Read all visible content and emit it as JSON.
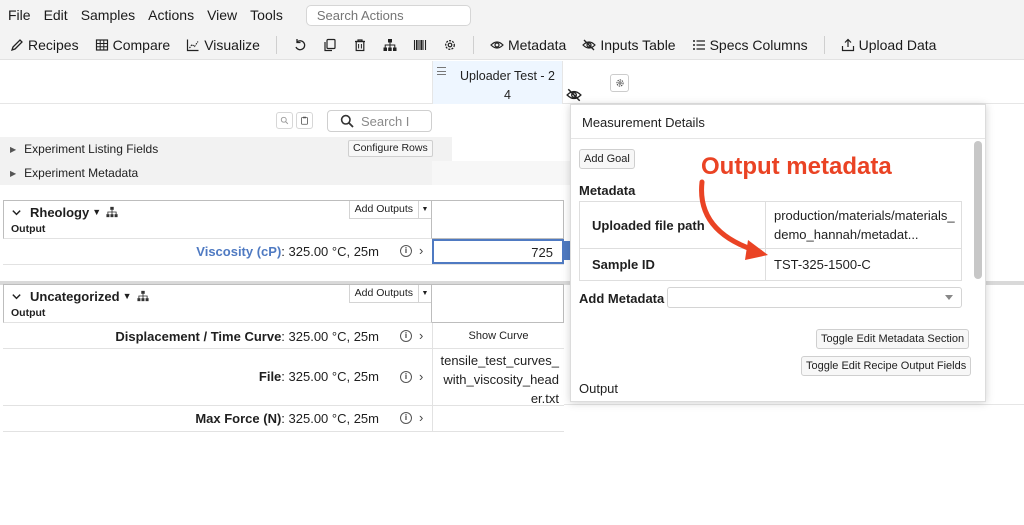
{
  "menubar": {
    "items": [
      "File",
      "Edit",
      "Samples",
      "Actions",
      "View",
      "Tools"
    ],
    "search_placeholder": "Search Actions"
  },
  "toolbar": {
    "recipes": "Recipes",
    "compare": "Compare",
    "visualize": "Visualize",
    "metadata": "Metadata",
    "inputs_table": "Inputs Table",
    "specs_columns": "Specs Columns",
    "upload_data": "Upload Data"
  },
  "sample_column": {
    "title": "Uploader Test - 2 4"
  },
  "search": {
    "placeholder": "Search I"
  },
  "sections": {
    "experiment_listing": "Experiment Listing Fields",
    "configure_rows": "Configure Rows",
    "experiment_metadata": "Experiment Metadata"
  },
  "groups": [
    {
      "name": "Rheology",
      "add_outputs": "Add Outputs",
      "output_label": "Output",
      "rows": [
        {
          "label": "Viscosity (cP)",
          "condition": ": 325.00 °C, 25m",
          "value": "725"
        }
      ]
    },
    {
      "name": "Uncategorized",
      "add_outputs": "Add Outputs",
      "output_label": "Output",
      "rows": [
        {
          "label": "Displacement / Time Curve",
          "condition": ": 325.00 °C, 25m",
          "value": "Show Curve"
        },
        {
          "label": "File",
          "condition": ": 325.00 °C, 25m",
          "value": "tensile_test_curves_with_viscosity_header.txt"
        },
        {
          "label": "Max Force (N)",
          "condition": ": 325.00 °C, 25m",
          "value": ""
        }
      ]
    }
  ],
  "panel": {
    "title": "Measurement Details",
    "add_goal": "Add Goal",
    "metadata_heading": "Metadata",
    "metadata_rows": [
      {
        "key": "Uploaded file path",
        "value": "production/materials/materials_demo_hannah/metadat..."
      },
      {
        "key": "Sample ID",
        "value": "TST-325-1500-C"
      }
    ],
    "add_metadata_label": "Add Metadata",
    "toggle_metadata": "Toggle Edit Metadata Section",
    "toggle_recipe": "Toggle Edit Recipe Output Fields",
    "output_label": "Output"
  },
  "annotation": {
    "text": "Output metadata",
    "color": "#ea4324"
  },
  "colors": {
    "accent_blue": "#4f7ac2",
    "column_highlight": "#eef6ff"
  }
}
